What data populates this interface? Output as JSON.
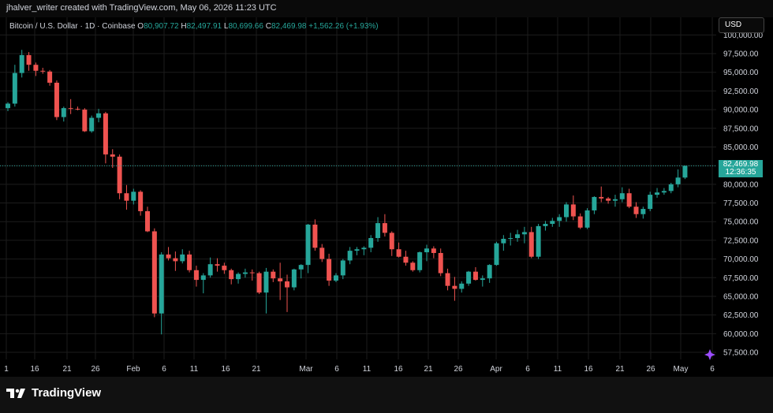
{
  "credit": "jhalver_writer created with TradingView.com, May 06, 2026 11:23 UTC",
  "legend": {
    "symbol": "Bitcoin / U.S. Dollar · 1D · Coinbase",
    "o_label": "O",
    "o": "80,907.72",
    "h_label": "H",
    "h": "82,497.91",
    "l_label": "L",
    "l": "80,699.66",
    "c_label": "C",
    "c": "82,469.98",
    "change": "+1,562.26 (+1.93%)"
  },
  "currency": "USD",
  "price_tag": {
    "price": "82,469.98",
    "countdown": "12:36:35"
  },
  "brand": "TradingView",
  "colors": {
    "up": "#26a69a",
    "down": "#ef5350",
    "background": "#000000",
    "grid": "#1c1c1c"
  },
  "chart_data": {
    "type": "candlestick",
    "x_tick_labels": [
      "1",
      "16",
      "21",
      "26",
      "Feb",
      "6",
      "11",
      "16",
      "21",
      "Mar",
      "6",
      "11",
      "16",
      "21",
      "26",
      "Apr",
      "6",
      "11",
      "16",
      "21",
      "26",
      "May",
      "6"
    ],
    "y_tick_labels": [
      "100,000.00",
      "97,500.00",
      "95,000.00",
      "92,500.00",
      "90,000.00",
      "87,500.00",
      "85,000.00",
      "82,500.00",
      "80,000.00",
      "77,500.00",
      "75,000.00",
      "72,500.00",
      "70,000.00",
      "67,500.00",
      "65,000.00",
      "62,500.00",
      "60,000.00",
      "57,500.00"
    ],
    "ylim": [
      56000,
      101000
    ],
    "last_price": 82469.98,
    "candles": [
      [
        90200,
        91000,
        89800,
        90800
      ],
      [
        90800,
        96000,
        90400,
        94900
      ],
      [
        94900,
        98000,
        94300,
        97300
      ],
      [
        97300,
        97700,
        95200,
        96000
      ],
      [
        96000,
        96300,
        94500,
        95200
      ],
      [
        95200,
        95600,
        94800,
        95100
      ],
      [
        95100,
        95300,
        93200,
        93600
      ],
      [
        93600,
        93900,
        88600,
        89000
      ],
      [
        89000,
        90400,
        88400,
        90200
      ],
      [
        90200,
        91400,
        89400,
        90100
      ],
      [
        90100,
        90400,
        89900,
        90000
      ],
      [
        90000,
        90200,
        87000,
        87100
      ],
      [
        87100,
        89200,
        86900,
        88900
      ],
      [
        88900,
        90100,
        88300,
        89500
      ],
      [
        89500,
        89700,
        82800,
        84000
      ],
      [
        84000,
        84700,
        82200,
        83700
      ],
      [
        83700,
        84000,
        78000,
        78800
      ],
      [
        78800,
        79900,
        76600,
        77800
      ],
      [
        77800,
        79400,
        77300,
        79000
      ],
      [
        79000,
        79200,
        75800,
        76400
      ],
      [
        76400,
        77000,
        73600,
        73700
      ],
      [
        73700,
        74100,
        62200,
        62700
      ],
      [
        62700,
        70900,
        59900,
        70600
      ],
      [
        70600,
        71600,
        69800,
        70100
      ],
      [
        70100,
        71000,
        68400,
        69700
      ],
      [
        69700,
        71300,
        69400,
        70600
      ],
      [
        70600,
        71100,
        68200,
        68500
      ],
      [
        68500,
        69100,
        66300,
        67200
      ],
      [
        67200,
        68100,
        65400,
        67800
      ],
      [
        67800,
        70200,
        67500,
        69300
      ],
      [
        69300,
        70100,
        68300,
        69100
      ],
      [
        69100,
        69500,
        68000,
        68500
      ],
      [
        68500,
        68700,
        66600,
        67300
      ],
      [
        67300,
        68200,
        66700,
        68000
      ],
      [
        68000,
        68700,
        67500,
        68200
      ],
      [
        68200,
        68600,
        67100,
        68100
      ],
      [
        68100,
        68300,
        65300,
        65500
      ],
      [
        65500,
        68800,
        62700,
        68300
      ],
      [
        68300,
        68600,
        66900,
        67400
      ],
      [
        67400,
        69500,
        64500,
        67000
      ],
      [
        67000,
        67900,
        62900,
        66200
      ],
      [
        66200,
        68700,
        65800,
        68600
      ],
      [
        68600,
        69300,
        67400,
        69200
      ],
      [
        69200,
        74700,
        68100,
        74600
      ],
      [
        74600,
        75300,
        71100,
        71500
      ],
      [
        71500,
        72000,
        69600,
        70000
      ],
      [
        70000,
        70700,
        66400,
        67100
      ],
      [
        67100,
        68100,
        66900,
        67800
      ],
      [
        67800,
        70000,
        67300,
        69800
      ],
      [
        69800,
        71600,
        69300,
        71100
      ],
      [
        71100,
        71600,
        70500,
        71300
      ],
      [
        71300,
        71700,
        70500,
        71500
      ],
      [
        71500,
        73200,
        70900,
        72800
      ],
      [
        72800,
        75600,
        72300,
        74800
      ],
      [
        74800,
        76000,
        73000,
        73500
      ],
      [
        73500,
        73700,
        70400,
        71300
      ],
      [
        71300,
        72200,
        70200,
        70300
      ],
      [
        70300,
        71100,
        69100,
        69500
      ],
      [
        69500,
        69700,
        68300,
        68500
      ],
      [
        68500,
        71000,
        68200,
        70900
      ],
      [
        70900,
        71900,
        69700,
        71400
      ],
      [
        71400,
        71700,
        70100,
        70800
      ],
      [
        70800,
        71400,
        67700,
        68100
      ],
      [
        68100,
        68700,
        65800,
        66400
      ],
      [
        66400,
        67600,
        64400,
        66000
      ],
      [
        66000,
        67000,
        65500,
        66700
      ],
      [
        66700,
        68400,
        66400,
        68300
      ],
      [
        68300,
        68900,
        67100,
        67200
      ],
      [
        67200,
        67800,
        66300,
        67400
      ],
      [
        67400,
        69300,
        66800,
        69200
      ],
      [
        69200,
        72300,
        69100,
        72100
      ],
      [
        72100,
        73200,
        71100,
        72700
      ],
      [
        72700,
        73500,
        71800,
        72800
      ],
      [
        72800,
        73900,
        72300,
        73300
      ],
      [
        73300,
        74300,
        72100,
        73600
      ],
      [
        73600,
        74300,
        70100,
        70300
      ],
      [
        70300,
        74700,
        70000,
        74400
      ],
      [
        74400,
        75100,
        73800,
        74700
      ],
      [
        74700,
        75500,
        74300,
        75100
      ],
      [
        75100,
        76000,
        74300,
        75600
      ],
      [
        75600,
        77600,
        75000,
        77300
      ],
      [
        77300,
        78500,
        75200,
        75700
      ],
      [
        75700,
        76100,
        74000,
        74200
      ],
      [
        74200,
        76800,
        74000,
        76500
      ],
      [
        76500,
        78400,
        76000,
        78300
      ],
      [
        78300,
        79700,
        77600,
        78100
      ],
      [
        78100,
        78300,
        77400,
        77800
      ],
      [
        77800,
        78600,
        77000,
        78000
      ],
      [
        78000,
        79600,
        77600,
        78800
      ],
      [
        78800,
        79400,
        76800,
        77000
      ],
      [
        77000,
        77600,
        75500,
        76000
      ],
      [
        76000,
        77000,
        75400,
        76700
      ],
      [
        76700,
        79000,
        76400,
        78600
      ],
      [
        78600,
        79500,
        78200,
        78900
      ],
      [
        78900,
        79500,
        78600,
        79100
      ],
      [
        79100,
        80200,
        78800,
        80000
      ],
      [
        80000,
        82000,
        79600,
        80900
      ],
      [
        80900,
        82500,
        80700,
        82470
      ]
    ]
  }
}
